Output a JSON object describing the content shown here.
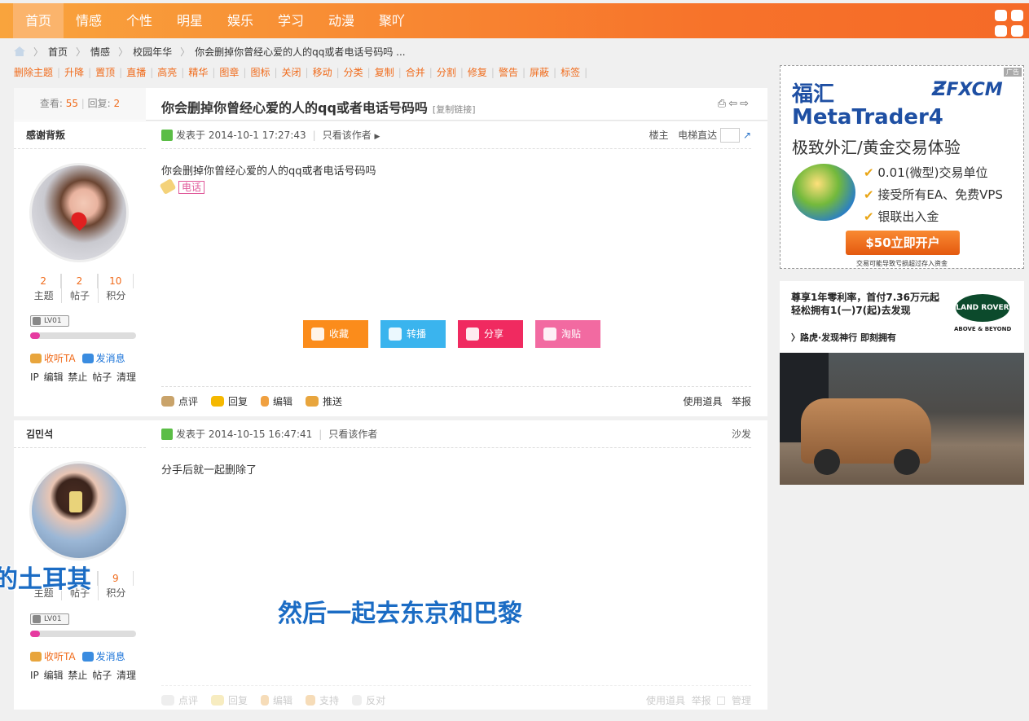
{
  "nav": {
    "items": [
      "首页",
      "情感",
      "个性",
      "明星",
      "娱乐",
      "学习",
      "动漫",
      "聚吖"
    ],
    "active": 0,
    "menu_icon": "grid-menu-icon"
  },
  "breadcrumb": {
    "home_icon": "home-icon",
    "items": [
      "首页",
      "情感",
      "校园年华",
      "你会删掉你曾经心爱的人的qq或者电话号码吗 ..."
    ]
  },
  "mod_actions": [
    "删除主题",
    "升降",
    "置顶",
    "直播",
    "高亮",
    "精华",
    "图章",
    "图标",
    "关闭",
    "移动",
    "分类",
    "复制",
    "合并",
    "分割",
    "修复",
    "警告",
    "屏蔽",
    "标签"
  ],
  "thread": {
    "views_label": "查看:",
    "views": "55",
    "replies_label": "回复:",
    "replies": "2",
    "title": "你会删掉你曾经心爱的人的qq或者电话号码吗",
    "copy_link": "[复制链接]"
  },
  "posts": [
    {
      "author": "感谢背叛",
      "stats": [
        {
          "value": "2",
          "label": "主题"
        },
        {
          "value": "2",
          "label": "帖子"
        },
        {
          "value": "10",
          "label": "积分"
        }
      ],
      "level": "LV01",
      "follow": "收听TA",
      "message": "发消息",
      "admin": "IP 编辑 禁止 帖子 清理",
      "posted": "发表于 2014-10-1 17:27:43",
      "only_author": "只看该作者",
      "floor": "楼主",
      "jump": "电梯直达",
      "body": "你会删掉你曾经心爱的人的qq或者电话号码吗",
      "tag": "电话",
      "actions": [
        {
          "label": "收藏",
          "color": "#fb8c1b"
        },
        {
          "label": "转播",
          "color": "#3ab4ee"
        },
        {
          "label": "分享",
          "color": "#f02a60"
        },
        {
          "label": "淘贴",
          "color": "#f26aa1"
        }
      ],
      "footer": [
        "点评",
        "回复",
        "编辑",
        "推送"
      ],
      "footer_right": [
        "使用道具",
        "举报"
      ]
    },
    {
      "author": "김민석",
      "stats": [
        {
          "value": "",
          "label": "主题"
        },
        {
          "value": "",
          "label": "帖子"
        },
        {
          "value": "9",
          "label": "积分"
        }
      ],
      "level": "LV01",
      "follow": "收听TA",
      "message": "发消息",
      "admin": "IP 编辑 禁止 帖子 清理",
      "posted": "发表于 2014-10-15 16:47:41",
      "only_author": "只看该作者",
      "floor": "沙发",
      "body": "分手后就一起删除了",
      "footer": [
        "点评",
        "回复",
        "编辑",
        "支持",
        "反对"
      ],
      "footer_right": [
        "使用道具",
        "举报",
        "管理"
      ]
    }
  ],
  "overlays": {
    "left": "的土耳其",
    "center": "然后一起去东京和巴黎"
  },
  "ads": {
    "fxcm": {
      "brand_cn": "福汇",
      "brand": "FXCM",
      "product": "MetaTrader4",
      "slogan": "极致外汇/黄金交易体验",
      "points": [
        "0.01(微型)交易单位",
        "接受所有EA、免费VPS",
        "银联出入金"
      ],
      "cta": "$50立即开户",
      "disclaimer": "交易可能导致亏损超过存入资金",
      "ad_label": "广告"
    },
    "landrover": {
      "line1": "尊享1年零利率，首付7.36万元起",
      "line2": "轻松拥有1(一)7(起)去发现",
      "line3": "〉路虎·发现神行 即刻拥有",
      "logo": "LAND ROVER",
      "tagline": "ABOVE & BEYOND"
    }
  }
}
